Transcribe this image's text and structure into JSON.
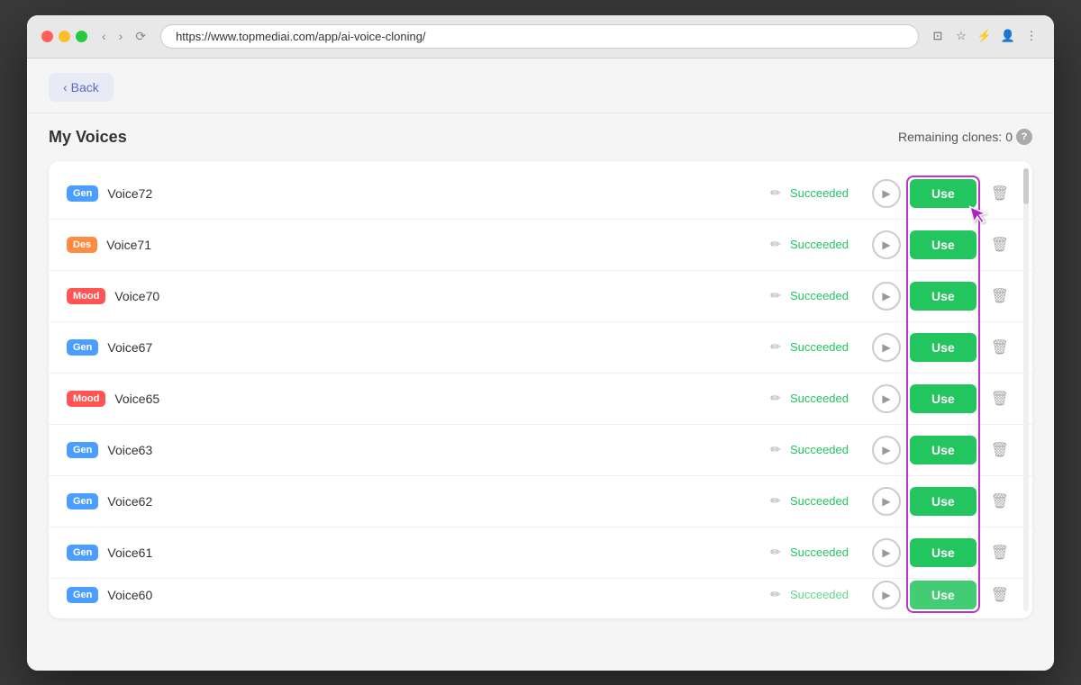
{
  "browser": {
    "url": "https://www.topmediai.com/app/ai-voice-cloning/",
    "back_label": "Back",
    "nav": {
      "back": "‹",
      "forward": "›",
      "reload": "⟳"
    }
  },
  "header": {
    "back_button": "Back",
    "page_title": "My Voices",
    "remaining_label": "Remaining clones:",
    "remaining_count": "0"
  },
  "voices": [
    {
      "id": 1,
      "tag": "Gen",
      "tag_class": "tag-gen",
      "name": "Voice72",
      "status": "Succeeded",
      "use_label": "Use"
    },
    {
      "id": 2,
      "tag": "Des",
      "tag_class": "tag-des",
      "name": "Voice71",
      "status": "Succeeded",
      "use_label": "Use"
    },
    {
      "id": 3,
      "tag": "Mood",
      "tag_class": "tag-mood",
      "name": "Voice70",
      "status": "Succeeded",
      "use_label": "Use"
    },
    {
      "id": 4,
      "tag": "Gen",
      "tag_class": "tag-gen",
      "name": "Voice67",
      "status": "Succeeded",
      "use_label": "Use"
    },
    {
      "id": 5,
      "tag": "Mood",
      "tag_class": "tag-mood",
      "name": "Voice65",
      "status": "Succeeded",
      "use_label": "Use"
    },
    {
      "id": 6,
      "tag": "Gen",
      "tag_class": "tag-gen",
      "name": "Voice63",
      "status": "Succeeded",
      "use_label": "Use"
    },
    {
      "id": 7,
      "tag": "Gen",
      "tag_class": "tag-gen",
      "name": "Voice62",
      "status": "Succeeded",
      "use_label": "Use"
    },
    {
      "id": 8,
      "tag": "Gen",
      "tag_class": "tag-gen",
      "name": "Voice61",
      "status": "Succeeded",
      "use_label": "Use"
    },
    {
      "id": 9,
      "tag": "Gen",
      "tag_class": "tag-gen",
      "name": "Voice60",
      "status": "Succeeded",
      "use_label": "Use"
    }
  ],
  "icons": {
    "edit": "✏",
    "play": "▶",
    "delete": "🗑",
    "help": "?",
    "chevron_left": "‹",
    "chevron_right": "›",
    "reload": "⟳"
  },
  "colors": {
    "succeeded": "#22c55e",
    "use_button": "#22c55e",
    "highlight_border": "#bb33cc",
    "tag_gen": "#4b9eff",
    "tag_des": "#ff8c42",
    "tag_mood": "#ff5555",
    "back_btn": "#e8eaf6",
    "back_text": "#5c6bc0"
  }
}
